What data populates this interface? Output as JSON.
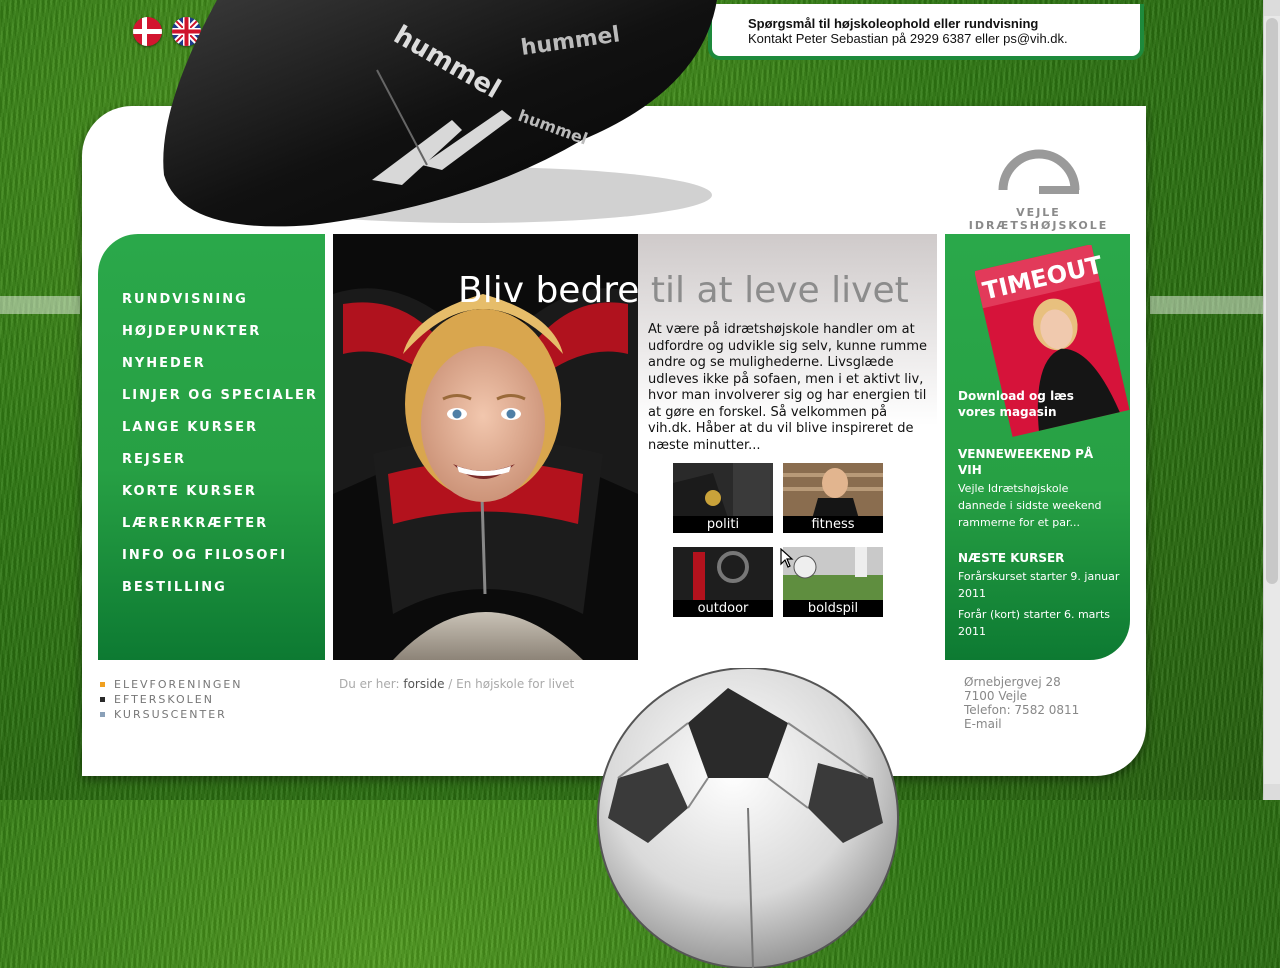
{
  "flags": [
    {
      "name": "danish-flag"
    },
    {
      "name": "english-flag"
    }
  ],
  "contact": {
    "title": "Spørgsmål til højskoleophold eller rundvisning",
    "line": "Kontakt Peter Sebastian på 2929 6387 eller ps@vih.dk."
  },
  "logo": {
    "text": "VEJLE IDRÆTSHØJSKOLE"
  },
  "nav": {
    "items": [
      "RUNDVISNING",
      "HØJDEPUNKTER",
      "NYHEDER",
      "LINJER OG SPECIALER",
      "LANGE KURSER",
      "REJSER",
      "KORTE KURSER",
      "LÆRERKRÆFTER",
      "INFO OG FILOSOFI",
      "BESTILLING"
    ]
  },
  "headline": {
    "part1": "Bliv bedre",
    "part2": " til at leve livet"
  },
  "intro": "At være på idrætshøjskole handler om at udfordre og udvikle sig selv, kunne rumme andre og se mulighederne. Livsglæde udleves ikke på sofaen, men i et aktivt liv, hvor man involverer sig og har energien til at gøre en forskel. Så velkommen på vih.dk. Håber at du vil blive inspireret de næste minutter...",
  "thumbs": [
    "politi",
    "fitness",
    "outdoor",
    "boldspil"
  ],
  "sidebar": {
    "magazine_title": "TIMEOUT",
    "magazine_link": "Download og læs vores magasin",
    "news1_title": "VENNEWEEKEND PÅ VIH",
    "news1_text": "Vejle Idrætshøjskole dannede i sidste weekend rammerne for et par...",
    "news2_title": "NÆSTE KURSER",
    "news2_text1": "Forårskurset starter 9. januar 2011",
    "news2_text2": "Forår (kort) starter 6. marts 2011"
  },
  "subsites": [
    {
      "label": "ELEVFORENINGEN",
      "color": "#f0a020"
    },
    {
      "label": "EFTERSKOLEN",
      "color": "#2a2a2a"
    },
    {
      "label": "KURSUSCENTER",
      "color": "#8aa0b8"
    }
  ],
  "breadcrumb": {
    "prefix": "Du er her: ",
    "home": "forside",
    "sep": " / ",
    "current": "En højskole for livet"
  },
  "address": {
    "street": "Ørnebjergvej 28",
    "city": "7100 Vejle",
    "phone": "Telefon: 7582 0811",
    "email": "E-mail"
  },
  "colors": {
    "green": "#27a044",
    "dark_green": "#0d7a32",
    "frame": "#1e8a3c"
  }
}
